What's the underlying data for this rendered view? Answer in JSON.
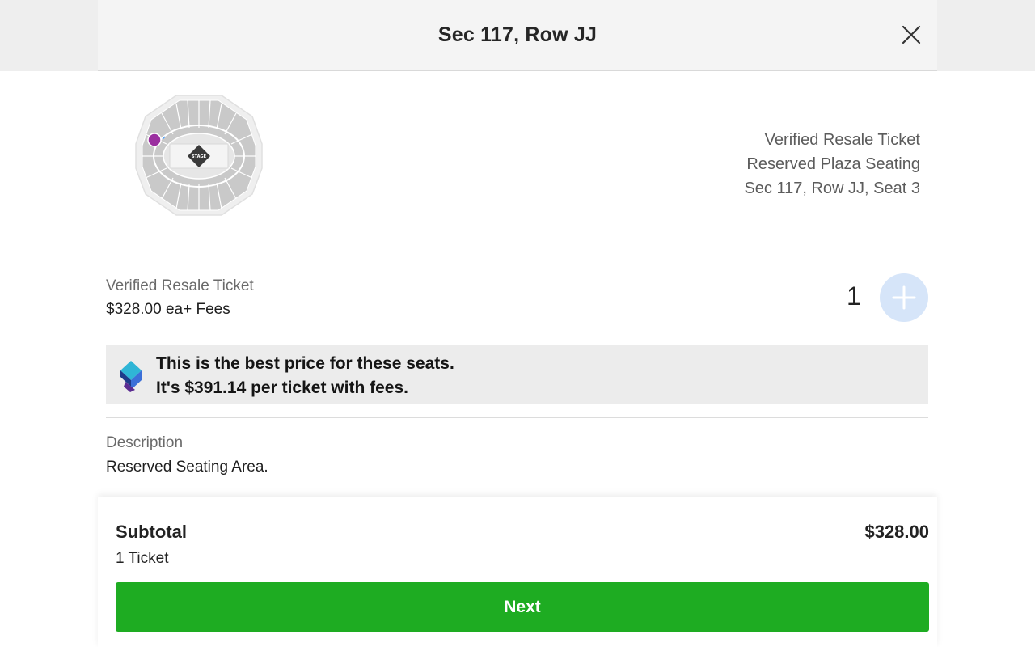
{
  "header": {
    "title": "Sec 117, Row JJ",
    "close_icon": "close-icon"
  },
  "seat_map": {
    "stage_label": "STAGE",
    "highlight_color": "#9b2fa0"
  },
  "ticket_info": {
    "line1": "Verified Resale Ticket",
    "line2": "Reserved Plaza Seating",
    "line3": "Sec 117, Row JJ, Seat 3"
  },
  "listing": {
    "type": "Verified Resale Ticket",
    "price": "$328.00 ea+ Fees",
    "quantity": "1",
    "add_icon": "plus-icon"
  },
  "best_price": {
    "line1": "This is the best price for these seats.",
    "line2": "It's $391.14 per ticket with fees.",
    "icon": "ticket-deal-icon"
  },
  "description": {
    "label": "Description",
    "text": "Reserved Seating Area."
  },
  "footer": {
    "subtotal_label": "Subtotal",
    "subtotal_amount": "$328.00",
    "ticket_count": "1 Ticket",
    "next_label": "Next"
  },
  "colors": {
    "accent_green": "#1eac22",
    "plus_button": "#d6e5f9",
    "banner_bg": "#ececec"
  }
}
